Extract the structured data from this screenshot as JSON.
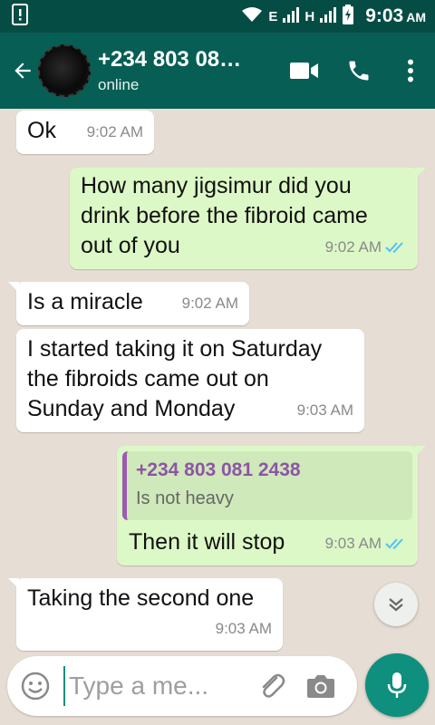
{
  "status_bar": {
    "network_e": "E",
    "network_h": "H",
    "time": "9:03",
    "ampm": "AM"
  },
  "header": {
    "contact_name": "+234 803 08…",
    "contact_status": "online"
  },
  "messages": [
    {
      "direction": "in",
      "text": "Ok",
      "time": "9:02 AM"
    },
    {
      "direction": "out",
      "lines": [
        "How many jigsimur did you",
        "drink before the fibroid came",
        "out of you"
      ],
      "time": "9:02 AM",
      "ticks": "read"
    },
    {
      "direction": "in",
      "text": "Is a miracle",
      "time": "9:02 AM"
    },
    {
      "direction": "in",
      "lines": [
        "I started taking it on Saturday",
        "the fibroids came out on",
        "Sunday and Monday"
      ],
      "time": "9:03 AM"
    },
    {
      "direction": "out",
      "quote_author": "+234 803 081 2438",
      "quote_text": "Is not heavy",
      "text": "Then it will stop",
      "time": "9:03 AM",
      "ticks": "read"
    },
    {
      "direction": "in",
      "text": "Taking the second one",
      "time": "9:03 AM"
    }
  ],
  "composer": {
    "placeholder": "Type a me..."
  },
  "colors": {
    "header": "#075e54",
    "status_bar": "#054d44",
    "outgoing_bubble": "#dcf8c6",
    "incoming_bubble": "#ffffff",
    "accent": "#0f8f7e",
    "read_ticks": "#4fc3f7",
    "quote_author": "#8e54a7"
  },
  "icons": [
    "notification-icon",
    "wifi-icon",
    "signal-icon",
    "battery-icon",
    "back-arrow-icon",
    "video-call-icon",
    "phone-icon",
    "more-vert-icon",
    "chevron-down-icon",
    "emoji-icon",
    "attach-icon",
    "camera-icon",
    "mic-icon",
    "double-check-icon"
  ]
}
